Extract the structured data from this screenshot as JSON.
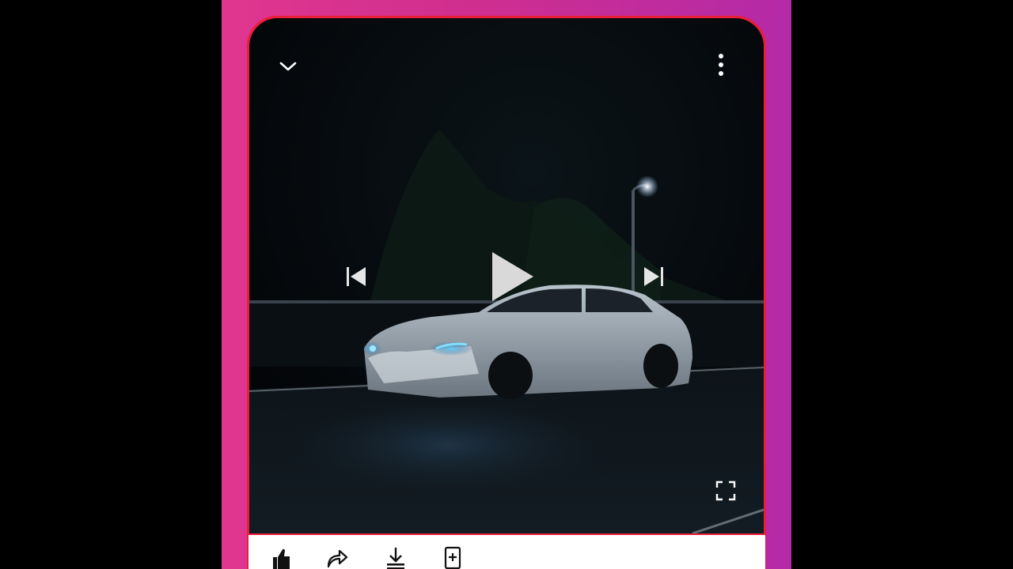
{
  "player": {
    "state": "paused",
    "icons": {
      "minimize": "chevron-down-icon",
      "more": "more-vertical-icon",
      "previous": "skip-previous-icon",
      "play": "play-icon",
      "next": "skip-next-icon",
      "fullscreen": "fullscreen-icon"
    }
  },
  "actions": [
    {
      "icon": "like-icon"
    },
    {
      "icon": "share-icon"
    },
    {
      "icon": "download-icon"
    },
    {
      "icon": "save-to-playlist-icon"
    }
  ],
  "colors": {
    "frame_gradient_start": "#e0368f",
    "frame_gradient_end": "#b42aa8",
    "screen_border": "#e81e3a",
    "headlight": "#3fb8ff"
  }
}
